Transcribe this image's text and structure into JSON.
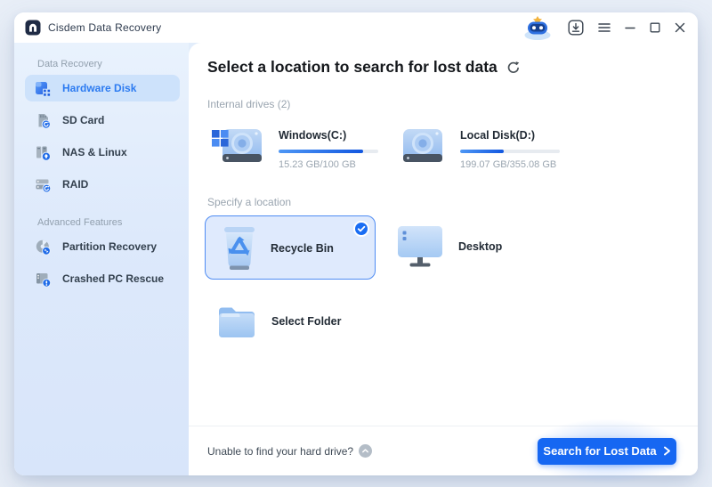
{
  "app": {
    "title": "Cisdem Data Recovery"
  },
  "titlebar": {
    "icons": [
      "assistant-mascot",
      "update",
      "menu",
      "minimize",
      "maximize",
      "close"
    ]
  },
  "sidebar": {
    "sections": [
      {
        "label": "Data Recovery"
      },
      {
        "label": "Advanced Features"
      }
    ],
    "items": [
      {
        "label": "Hardware Disk",
        "selected": true
      },
      {
        "label": "SD Card",
        "selected": false
      },
      {
        "label": "NAS & Linux",
        "selected": false
      },
      {
        "label": "RAID",
        "selected": false
      }
    ],
    "advanced_items": [
      {
        "label": "Partition Recovery",
        "selected": false
      },
      {
        "label": "Crashed PC Rescue",
        "selected": false
      }
    ]
  },
  "main": {
    "heading": "Select a location to search for lost data",
    "sections": {
      "internal_drives": "Internal drives (2)",
      "specify_location": "Specify a location"
    },
    "drives": [
      {
        "name": "Windows(C:)",
        "capacity": "15.23 GB/100 GB",
        "used_percent": 85
      },
      {
        "name": "Local Disk(D:)",
        "capacity": "199.07 GB/355.08 GB",
        "used_percent": 44
      }
    ],
    "locations": [
      {
        "label": "Recycle Bin",
        "selected": true
      },
      {
        "label": "Desktop",
        "selected": false
      },
      {
        "label": "Select Folder",
        "selected": false
      }
    ],
    "footer": {
      "help_text": "Unable to find your hard drive?",
      "search_button": "Search for Lost Data"
    }
  },
  "colors": {
    "accent_blue": "#1a6df3",
    "button_bg": "#1667f2",
    "sidebar_selected_bg": "#cde2fb",
    "sidebar_selected_text": "#2c7bf1",
    "card_selected_bg": "#dfeafd",
    "card_selected_border": "#4f8cf3",
    "progress_fill_start": "#4e97f5",
    "progress_fill_end": "#1257e0",
    "page_background": "#e8eef7"
  }
}
